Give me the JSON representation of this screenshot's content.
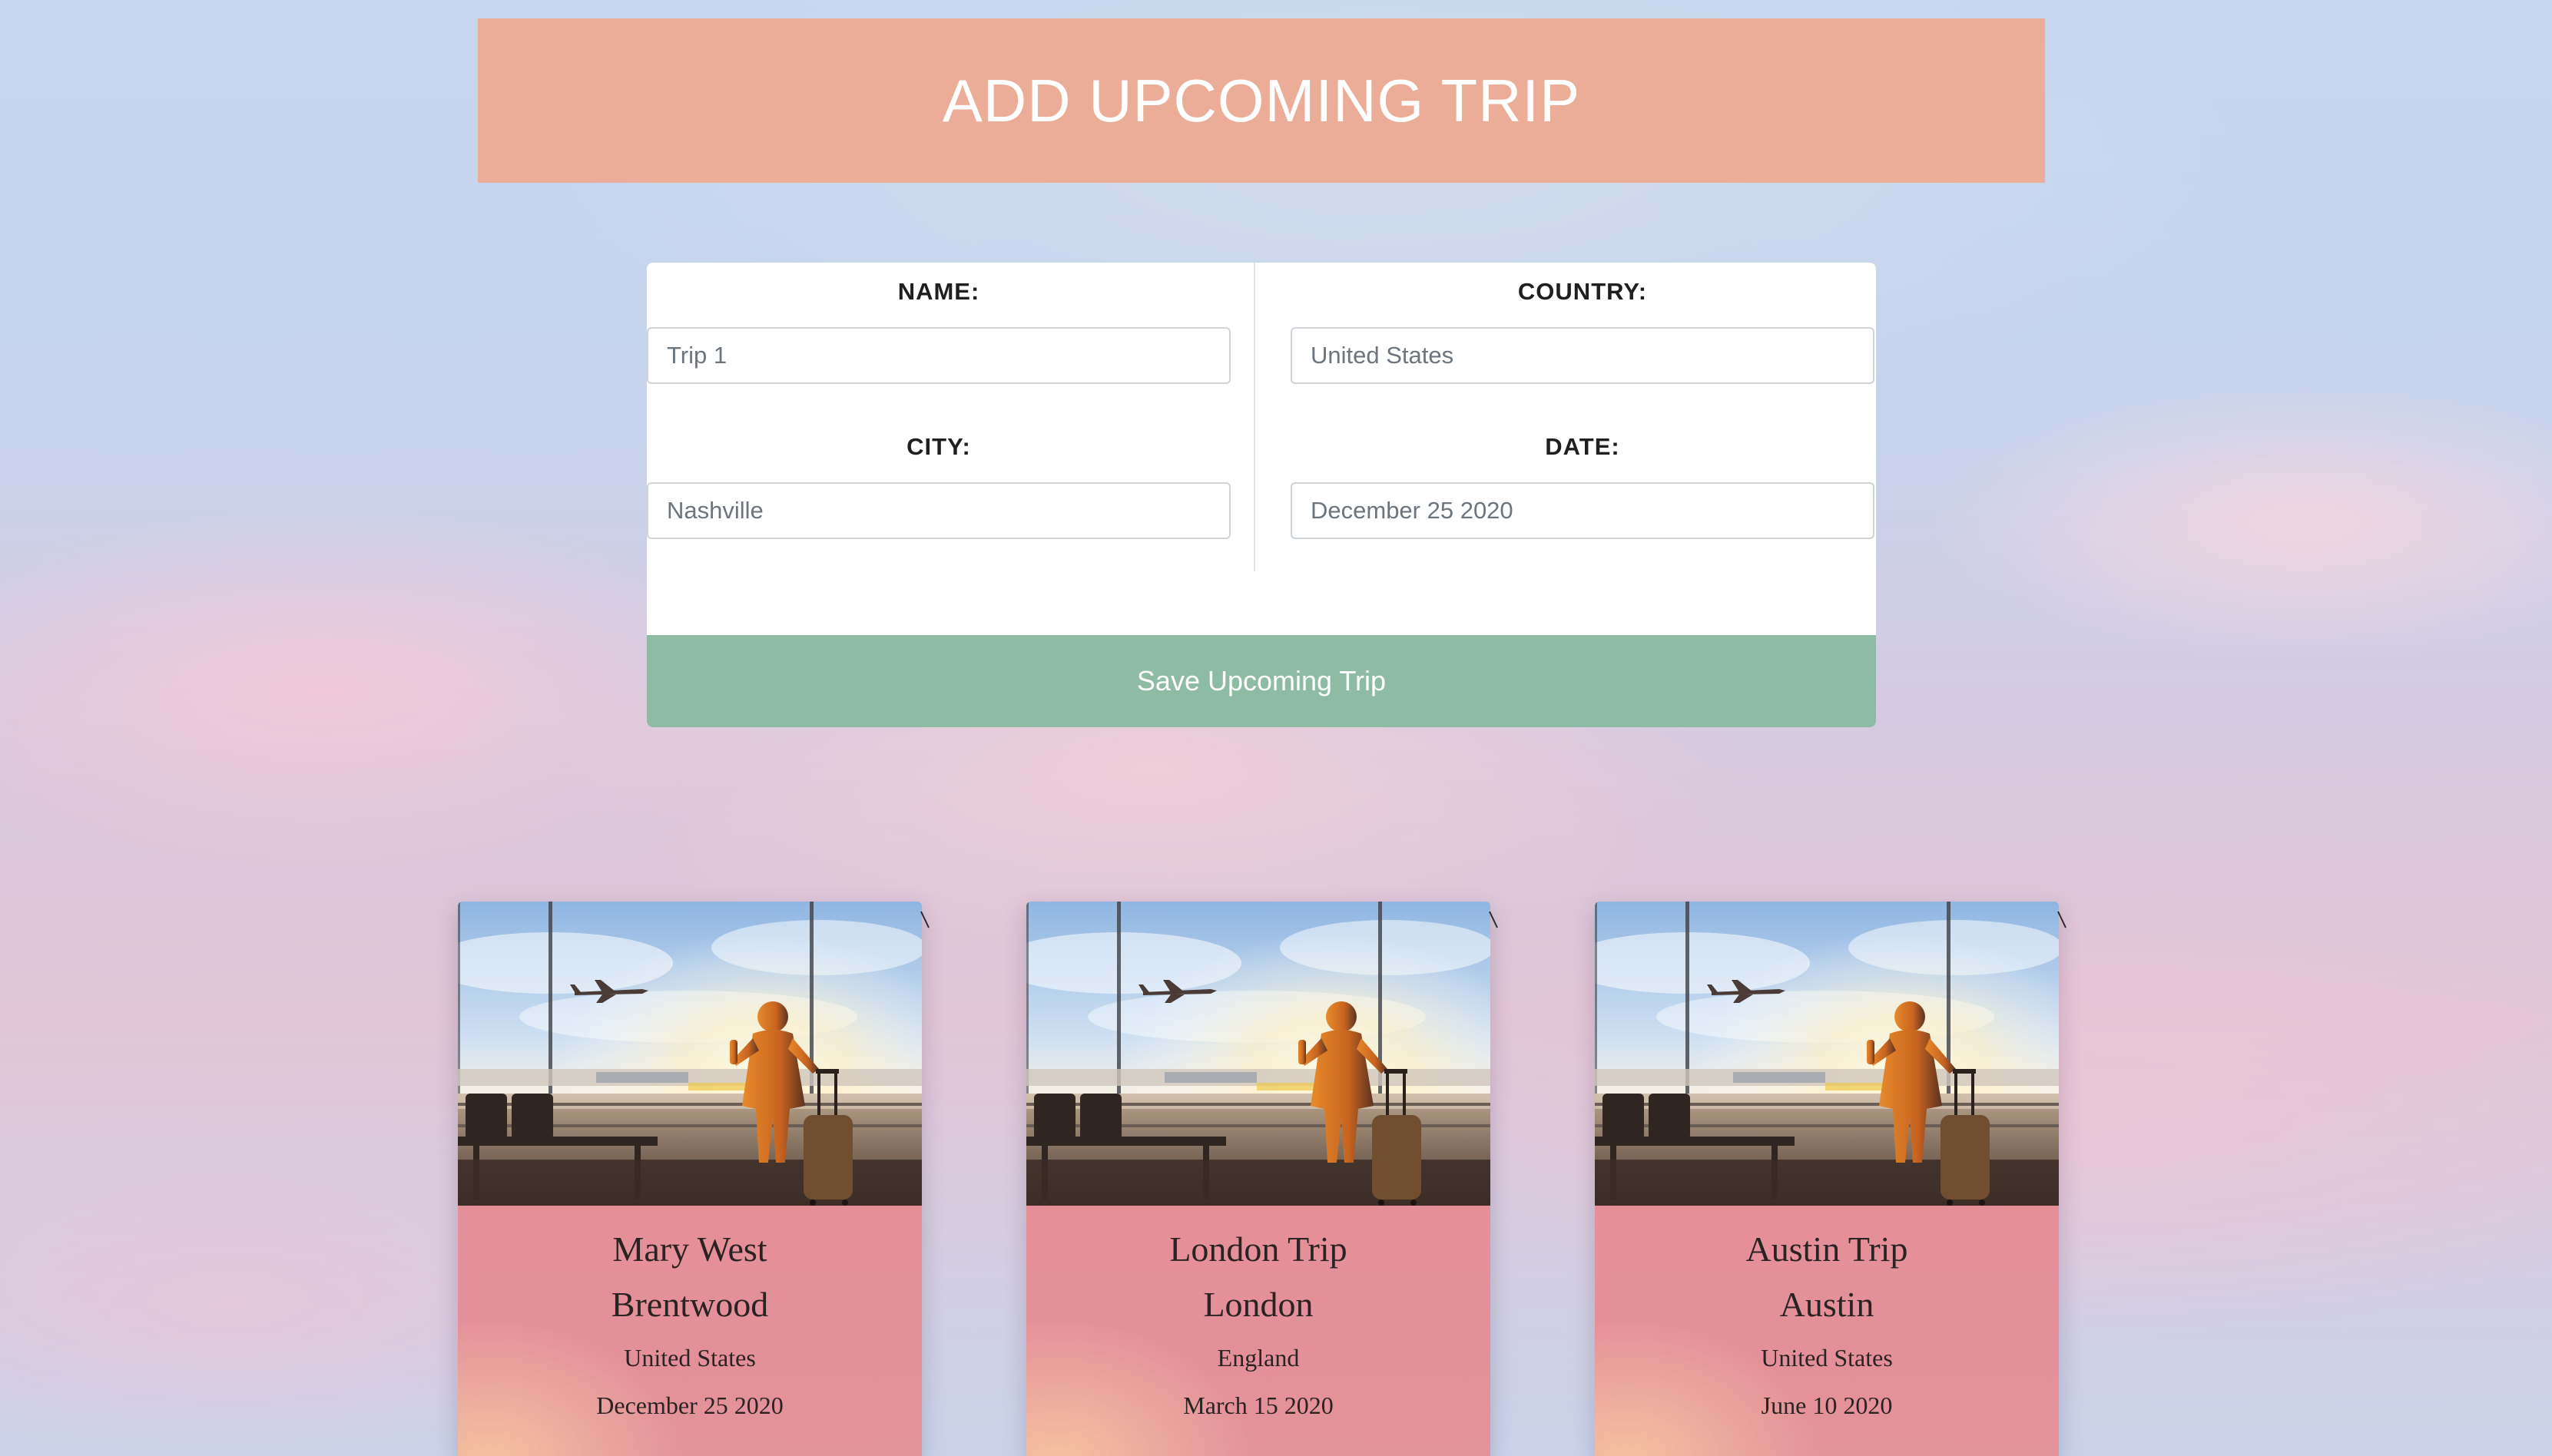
{
  "header": {
    "title": "ADD UPCOMING TRIP"
  },
  "form": {
    "name": {
      "label": "NAME:",
      "value": "",
      "placeholder": "Trip 1"
    },
    "country": {
      "label": "COUNTRY:",
      "value": "",
      "placeholder": "United States"
    },
    "city": {
      "label": "CITY:",
      "value": "",
      "placeholder": "Nashville"
    },
    "date": {
      "label": "DATE:",
      "value": "",
      "placeholder": "December 25 2020"
    },
    "save_label": "Save Upcoming Trip"
  },
  "trips": [
    {
      "name": "Mary West",
      "city": "Brentwood",
      "country": "United States",
      "date": "December 25 2020"
    },
    {
      "name": "London Trip",
      "city": "London",
      "country": "England",
      "date": "March 15 2020"
    },
    {
      "name": "Austin Trip",
      "city": "Austin",
      "country": "United States",
      "date": "June 10 2020"
    }
  ],
  "colors": {
    "header_bg": "#ecad98",
    "save_button_bg": "#8ebba4",
    "card_body": "#e58f99"
  },
  "icons": {
    "trip_photo": "airport-traveler-photo"
  }
}
